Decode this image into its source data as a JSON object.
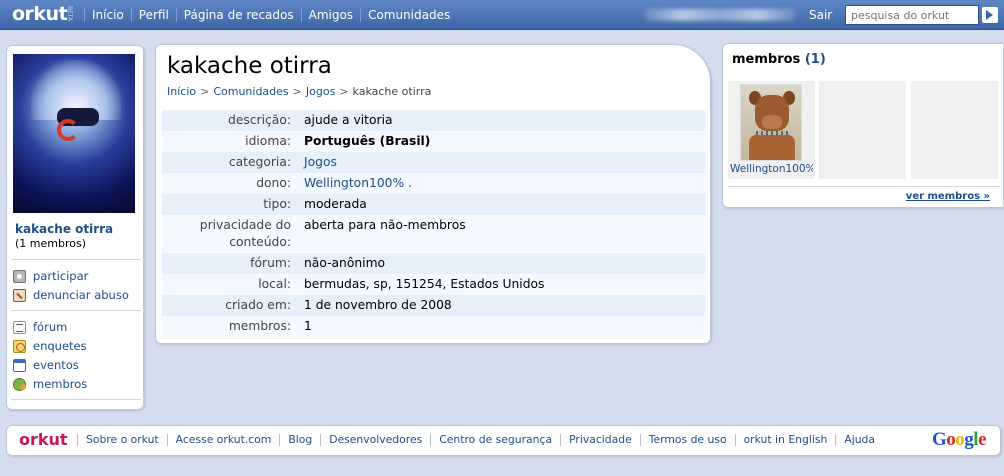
{
  "topbar": {
    "logo": "orkut",
    "logo_beta": "BETA",
    "nav": [
      "Início",
      "Perfil",
      "Página de recados",
      "Amigos",
      "Comunidades"
    ],
    "logout": "Sair",
    "search_placeholder": "pesquisa do orkut"
  },
  "left": {
    "community_name": "kakache otirra",
    "members_count": "(1 membros)",
    "actions": [
      {
        "label": "participar",
        "icon": "join-icon"
      },
      {
        "label": "denunciar abuso",
        "icon": "report-icon"
      }
    ],
    "sections": [
      {
        "label": "fórum",
        "icon": "forum-icon"
      },
      {
        "label": "enquetes",
        "icon": "poll-icon"
      },
      {
        "label": "eventos",
        "icon": "calendar-icon"
      },
      {
        "label": "membros",
        "icon": "members-icon"
      }
    ]
  },
  "main": {
    "title": "kakache otirra",
    "breadcrumb": [
      "Início",
      "Comunidades",
      "Jogos",
      "kakache otirra"
    ],
    "rows": [
      {
        "label": "descrição:",
        "value": "ajude a vitoria",
        "style": ""
      },
      {
        "label": "idioma:",
        "value": "Português (Brasil)",
        "style": "bold"
      },
      {
        "label": "categoria:",
        "value": "Jogos",
        "style": "link"
      },
      {
        "label": "dono:",
        "value": "Wellington100% .",
        "style": "link"
      },
      {
        "label": "tipo:",
        "value": "moderada",
        "style": ""
      },
      {
        "label": "privacidade do conteúdo:",
        "value": "aberta para não-membros",
        "style": ""
      },
      {
        "label": "fórum:",
        "value": "não-anônimo",
        "style": ""
      },
      {
        "label": "local:",
        "value": "bermudas, sp, 151254, Estados Unidos",
        "style": ""
      },
      {
        "label": "criado em:",
        "value": "1 de novembro de 2008",
        "style": ""
      },
      {
        "label": "membros:",
        "value": "1",
        "style": ""
      }
    ]
  },
  "right": {
    "title": "membros",
    "count": "(1)",
    "member_name": "Wellington100%",
    "see_all": "ver membros »"
  },
  "footer": {
    "logo": "orkut",
    "links": [
      "Sobre o orkut",
      "Acesse orkut.com",
      "Blog",
      "Desenvolvedores",
      "Centro de segurança",
      "Privacidade",
      "Termos de uso",
      "orkut in English",
      "Ajuda"
    ],
    "google": [
      "G",
      "o",
      "o",
      "g",
      "l",
      "e"
    ]
  }
}
